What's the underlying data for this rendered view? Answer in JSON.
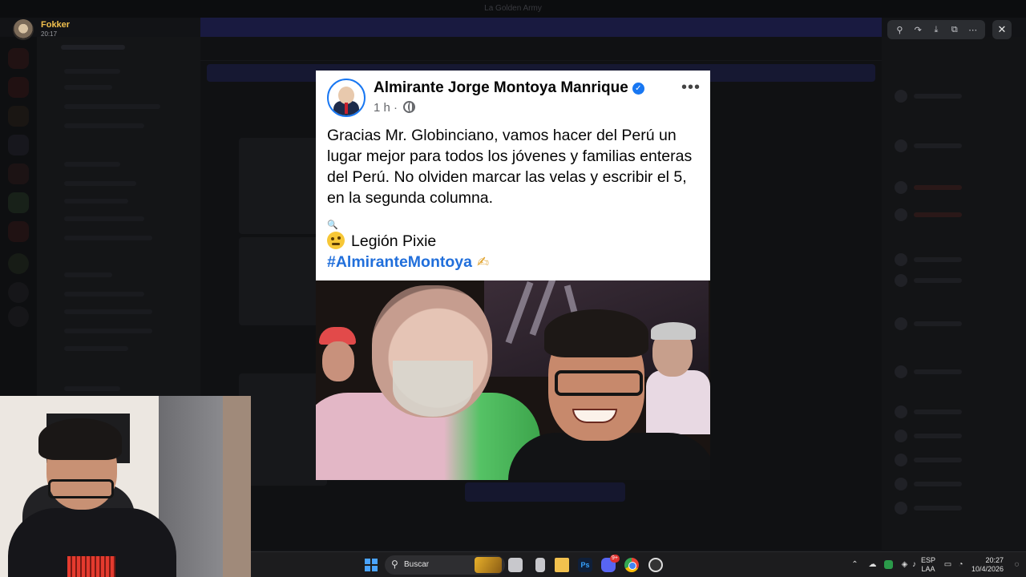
{
  "window": {
    "title": "La Golden Army"
  },
  "viewer": {
    "username": "Fokker",
    "time": "20:17",
    "tools": [
      "zoom-icon",
      "forward-icon",
      "download-icon",
      "open-external-icon",
      "more-icon"
    ],
    "close_label": "✕"
  },
  "post": {
    "author": "Almirante Jorge Montoya Manrique",
    "verified_mark": "✓",
    "meta_time": "1 h ·",
    "more": "•••",
    "text": "Gracias Mr. Globinciano, vamos hacer del Perú un lugar mejor para todos los jóvenes y familias enteras del Perú. No olviden marcar las velas y escribir el 5, en la segunda columna.",
    "mag": "🔍",
    "signature": "Legión Pixie",
    "hashtag": "#AlmiranteMontoya",
    "pen": "✍"
  },
  "taskbar": {
    "search_label": "Buscar",
    "ps_label": "Ps",
    "discord_badge": "9+",
    "lang_top": "ESP",
    "lang_bottom": "LAA",
    "clock_time": "20:27",
    "clock_date": "10/4/2026"
  },
  "colors": {
    "username": "#f2c14e",
    "hashtag": "#216fdb",
    "verified": "#1877f2",
    "banner": "#191a40"
  }
}
